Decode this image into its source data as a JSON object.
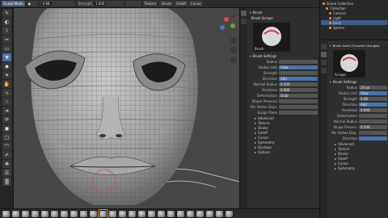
{
  "topbar": {
    "mode": "Sculpt Mode",
    "items": [
      {
        "label": "",
        "value": "0.68"
      },
      {
        "label": "Strength",
        "value": "1.000"
      },
      {
        "label": "",
        "value": ""
      }
    ],
    "right_items": [
      "Brush",
      "Texture",
      "Stroke",
      "Falloff",
      "Cursor"
    ]
  },
  "toolbar": {
    "tools": [
      "draw-icon",
      "clay-icon",
      "crease-icon",
      "smooth-icon",
      "flatten-icon",
      "fill-icon",
      "scrape-icon",
      "pinch-icon",
      "grab-icon",
      "snake-hook-icon",
      "thumb-icon",
      "nudge-icon",
      "rotate-icon",
      "mask-icon",
      "box-mask-icon",
      "lasso-mask-icon",
      "annotate-icon",
      "transform-icon",
      "mesh-filter-icon",
      "cloth-icon"
    ]
  },
  "props1": {
    "brush_header": "Brush",
    "preview_label": "Brush",
    "preview_header": "Brush Scrape",
    "settings_header": "Brush Settings",
    "rows": [
      {
        "k": "Radius",
        "v": ""
      },
      {
        "k": "Radius Unit",
        "v": "View"
      },
      {
        "k": "Strength",
        "v": ""
      },
      {
        "k": "Direction",
        "v": "Add"
      },
      {
        "k": "Normal Radius",
        "v": "0.500"
      },
      {
        "k": "Hardness",
        "v": "0.000"
      },
      {
        "k": "Deformation",
        "v": "Grab"
      },
      {
        "k": "Shape Preserve",
        "v": ""
      },
      {
        "k": "Per Vertex Displ.",
        "v": ""
      },
      {
        "k": "Sculpt Plane",
        "v": ""
      }
    ],
    "subpanels": [
      "Advanced",
      "Texture",
      "Stroke",
      "Falloff",
      "Cursor",
      "Symmetry",
      "Dyntopo",
      "Options"
    ]
  },
  "outliner": {
    "rows": [
      "Scene Collection",
      "Collection",
      "Camera",
      "Light",
      "Body",
      "Sphere"
    ]
  },
  "props2": {
    "brush_header": "Brush Asset (Unsaved Changes)",
    "preview_label": "Scrape",
    "settings_header": "Brush Settings",
    "rows": [
      {
        "k": "Radius",
        "v": "24 px"
      },
      {
        "k": "Radius Unit",
        "v": "View"
      },
      {
        "k": "Strength",
        "v": "0.68"
      },
      {
        "k": "Direction",
        "v": "Add"
      },
      {
        "k": "Hardness",
        "v": "0.000"
      },
      {
        "k": "Deformation",
        "v": ""
      },
      {
        "k": "Normal Radius",
        "v": ""
      },
      {
        "k": "Shape Preserv.",
        "v": "0.500"
      },
      {
        "k": "Per Vertex Disp.",
        "v": ""
      },
      {
        "k": "Direction",
        "v": ""
      }
    ],
    "subpanels": [
      "Advanced",
      "Texture",
      "Stroke",
      "Falloff",
      "Cursor",
      "Symmetry"
    ]
  },
  "brushbar": {
    "count": 24
  },
  "colors": {
    "accent": "#4a72a8",
    "selection": "#e8963a",
    "viewport_bg": "#474747"
  }
}
